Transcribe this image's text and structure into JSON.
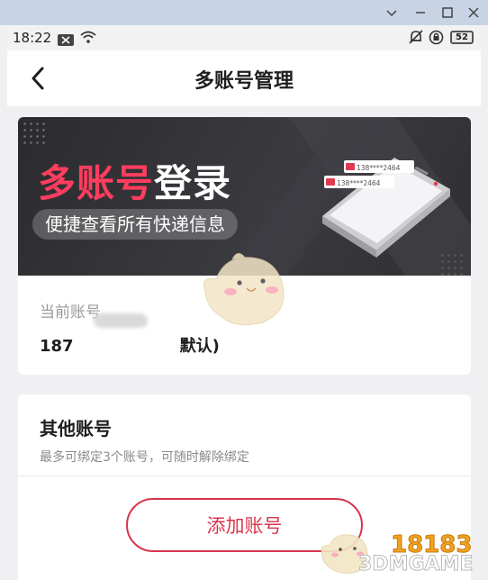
{
  "status_bar": {
    "time": "18:22",
    "battery": "52"
  },
  "header": {
    "title": "多账号管理"
  },
  "banner": {
    "title_highlight": "多账号",
    "title_rest": "登录",
    "subtitle": "便捷查看所有快递信息",
    "sms_1": "138****2464",
    "sms_2": "138****2464"
  },
  "current_account": {
    "label": "当前账号",
    "number_visible": "187",
    "suffix": "默认)"
  },
  "other_accounts": {
    "title": "其他账号",
    "description": "最多可绑定3个账号，可随时解除绑定",
    "add_button": "添加账号"
  },
  "watermark": {
    "logo_text": "18183",
    "site_text": "3DMGAME"
  },
  "colors": {
    "accent": "#d8354c",
    "banner_highlight": "#ff3d5e",
    "window_bar": "#c8d3e6"
  }
}
